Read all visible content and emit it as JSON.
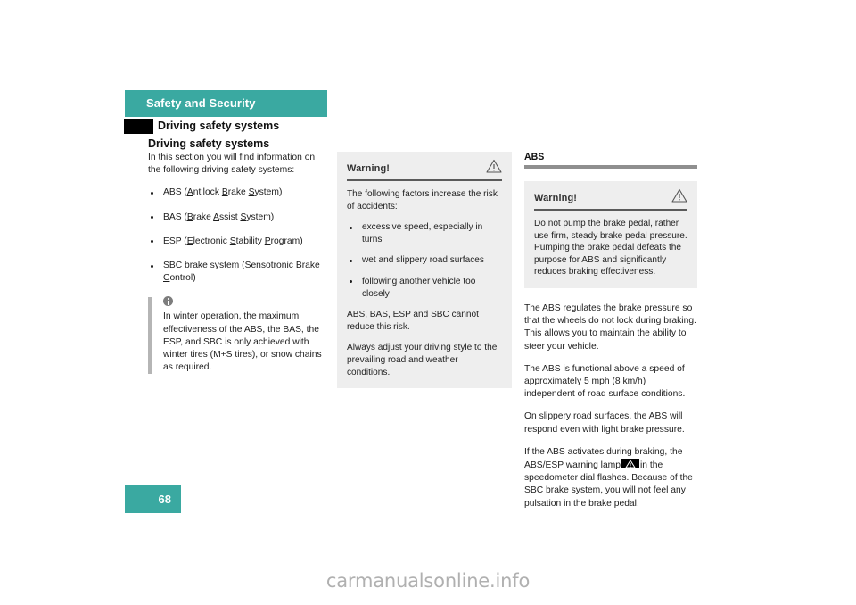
{
  "page": {
    "chapter_title": "Safety and Security",
    "section_heading": "Driving safety systems",
    "subsection_heading": "Driving safety systems",
    "page_number": "68",
    "watermark": "carmanualsonline.info",
    "accent_color": "#3aa9a1",
    "tab_marker_color": "#000000",
    "warning_box_bg": "#eeeeee"
  },
  "column1": {
    "intro": "In this section you will find information on the following driving safety systems:",
    "systems": [
      {
        "prefix": "ABS (",
        "parts": [
          "A",
          "ntilock ",
          "B",
          "rake ",
          "S",
          "ystem"
        ],
        "suffix": ")"
      },
      {
        "prefix": "BAS (",
        "parts": [
          "B",
          "rake ",
          "A",
          "ssist ",
          "S",
          "ystem"
        ],
        "suffix": ")"
      },
      {
        "prefix": "ESP (",
        "parts": [
          "E",
          "lectronic ",
          "S",
          "tability ",
          "P",
          "rogram"
        ],
        "suffix": ")"
      },
      {
        "prefix": "SBC brake system (",
        "parts": [
          "S",
          "ensotronic ",
          "B",
          "rake ",
          "C",
          "ontrol"
        ],
        "suffix": ")"
      }
    ],
    "note": {
      "icon": "info-icon",
      "text": "In winter operation, the maximum effectiveness of the ABS, the BAS, the ESP, and SBC is only achieved with winter tires (M+S tires), or snow chains as required."
    }
  },
  "column2": {
    "warning": {
      "title": "Warning!",
      "icon": "warning-triangle-icon",
      "intro": "The following factors increase the risk of accidents:",
      "factors": [
        "excessive speed, especially in turns",
        "wet and slippery road surfaces",
        "following another vehicle too closely"
      ],
      "paragraph_1": "ABS, BAS, ESP and SBC cannot reduce this risk.",
      "paragraph_2": "Always adjust your driving style to the prevailing road and weather conditions."
    }
  },
  "column3": {
    "heading": "ABS",
    "warning": {
      "title": "Warning!",
      "icon": "warning-triangle-icon",
      "text": "Do not pump the brake pedal, rather use firm, steady brake pedal pressure. Pumping the brake pedal defeats the purpose for ABS and significantly reduces braking effectiveness."
    },
    "paragraph_1": "The ABS regulates the brake pressure so that the wheels do not lock during braking. This allows you to maintain the ability to steer your vehicle.",
    "paragraph_2": "The ABS is functional above a speed of approximately 5 mph (8 km/h) independent of road surface conditions.",
    "paragraph_3": "On slippery road surfaces, the ABS will respond even with light brake pressure.",
    "paragraph_4a": "If the ABS activates during braking, the ABS/ESP warning lamp",
    "lamp_icon": "abs-esp-warning-lamp-icon",
    "paragraph_4b": "in the speedometer dial flashes. Because of the SBC brake system, you will not feel any pulsation in the brake pedal."
  }
}
